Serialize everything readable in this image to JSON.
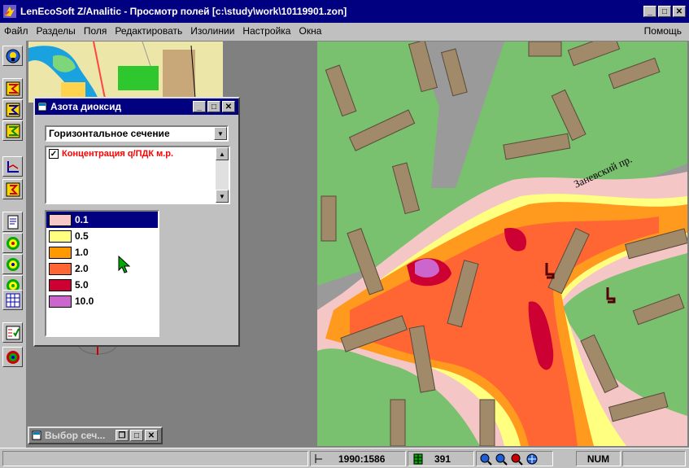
{
  "window": {
    "title": "LenEcoSoft Z/Analitic  -  Просмотр полей  [c:\\study\\work\\10119901.zon]"
  },
  "menu": {
    "items": [
      {
        "label": "Файл"
      },
      {
        "label": "Разделы"
      },
      {
        "label": "Поля"
      },
      {
        "label": "Редактировать"
      },
      {
        "label": "Изолинии"
      },
      {
        "label": "Настройка"
      },
      {
        "label": "Окна"
      }
    ],
    "help": "Помощь"
  },
  "toolbar": {
    "icons": [
      "zoom-view-icon",
      "sum-layer-icon",
      "sum-field-icon",
      "sum-layer-2-icon",
      "axis-icon",
      "sum-box-icon",
      "report-icon",
      "contour-green-icon",
      "contour-green-2-icon",
      "contour-green-3-icon",
      "grid-table-icon",
      "check-list-icon",
      "contour-multi-icon"
    ]
  },
  "float_window": {
    "title": "Азота диоксид",
    "section_select": "Горизонтальное сечение",
    "list_item": "Концентрация   q/ПДК м.р.",
    "legend": [
      {
        "value": "0.1",
        "color": "#f7c8c8"
      },
      {
        "value": "0.5",
        "color": "#ffff80"
      },
      {
        "value": "1.0",
        "color": "#ff9900"
      },
      {
        "value": "2.0",
        "color": "#ff6633"
      },
      {
        "value": "5.0",
        "color": "#cc0033"
      },
      {
        "value": "10.0",
        "color": "#cc66cc"
      }
    ]
  },
  "minimized_window": {
    "title": "Выбор сеч..."
  },
  "map": {
    "street_label": "Заневский пр."
  },
  "status": {
    "coords": "1990:1586",
    "count": "391",
    "num": "NUM"
  }
}
